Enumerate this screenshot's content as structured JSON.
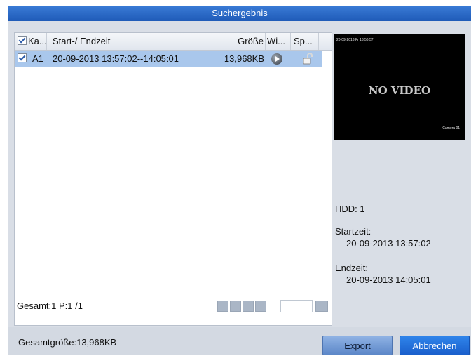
{
  "title": "Suchergebnis",
  "list": {
    "headers": {
      "select_all_checked": true,
      "kanal": "Ka...",
      "time": "Start-/ Endzeit",
      "size": "Größe",
      "wi": "Wi...",
      "sp": "Sp..."
    },
    "rows": [
      {
        "checked": true,
        "kanal": "A1",
        "time": "20-09-2013 13:57:02--14:05:01",
        "size": "13,968KB",
        "action_icon": "play-icon",
        "lock_icon": "unlocked-icon"
      }
    ]
  },
  "status": {
    "summary": "Gesamt:1 P:1 /1"
  },
  "preview": {
    "overlay_timestamp": "20-09-2013 Fr 13:56:57 ",
    "message": "NO VIDEO",
    "camera_label": "Camera 01"
  },
  "details": {
    "hdd": "HDD: 1",
    "start_label": "Startzeit:",
    "start_value": "20-09-2013 13:57:02",
    "end_label": "Endzeit:",
    "end_value": "20-09-2013 14:05:01"
  },
  "footer": {
    "total_size": "Gesamtgröße:13,968KB",
    "export_label": "Export",
    "cancel_label": "Abbrechen"
  },
  "colors": {
    "titlebar": "#1f5bb8",
    "selected_row": "#a9c7ec",
    "cancel_button": "#1a5fcc"
  }
}
